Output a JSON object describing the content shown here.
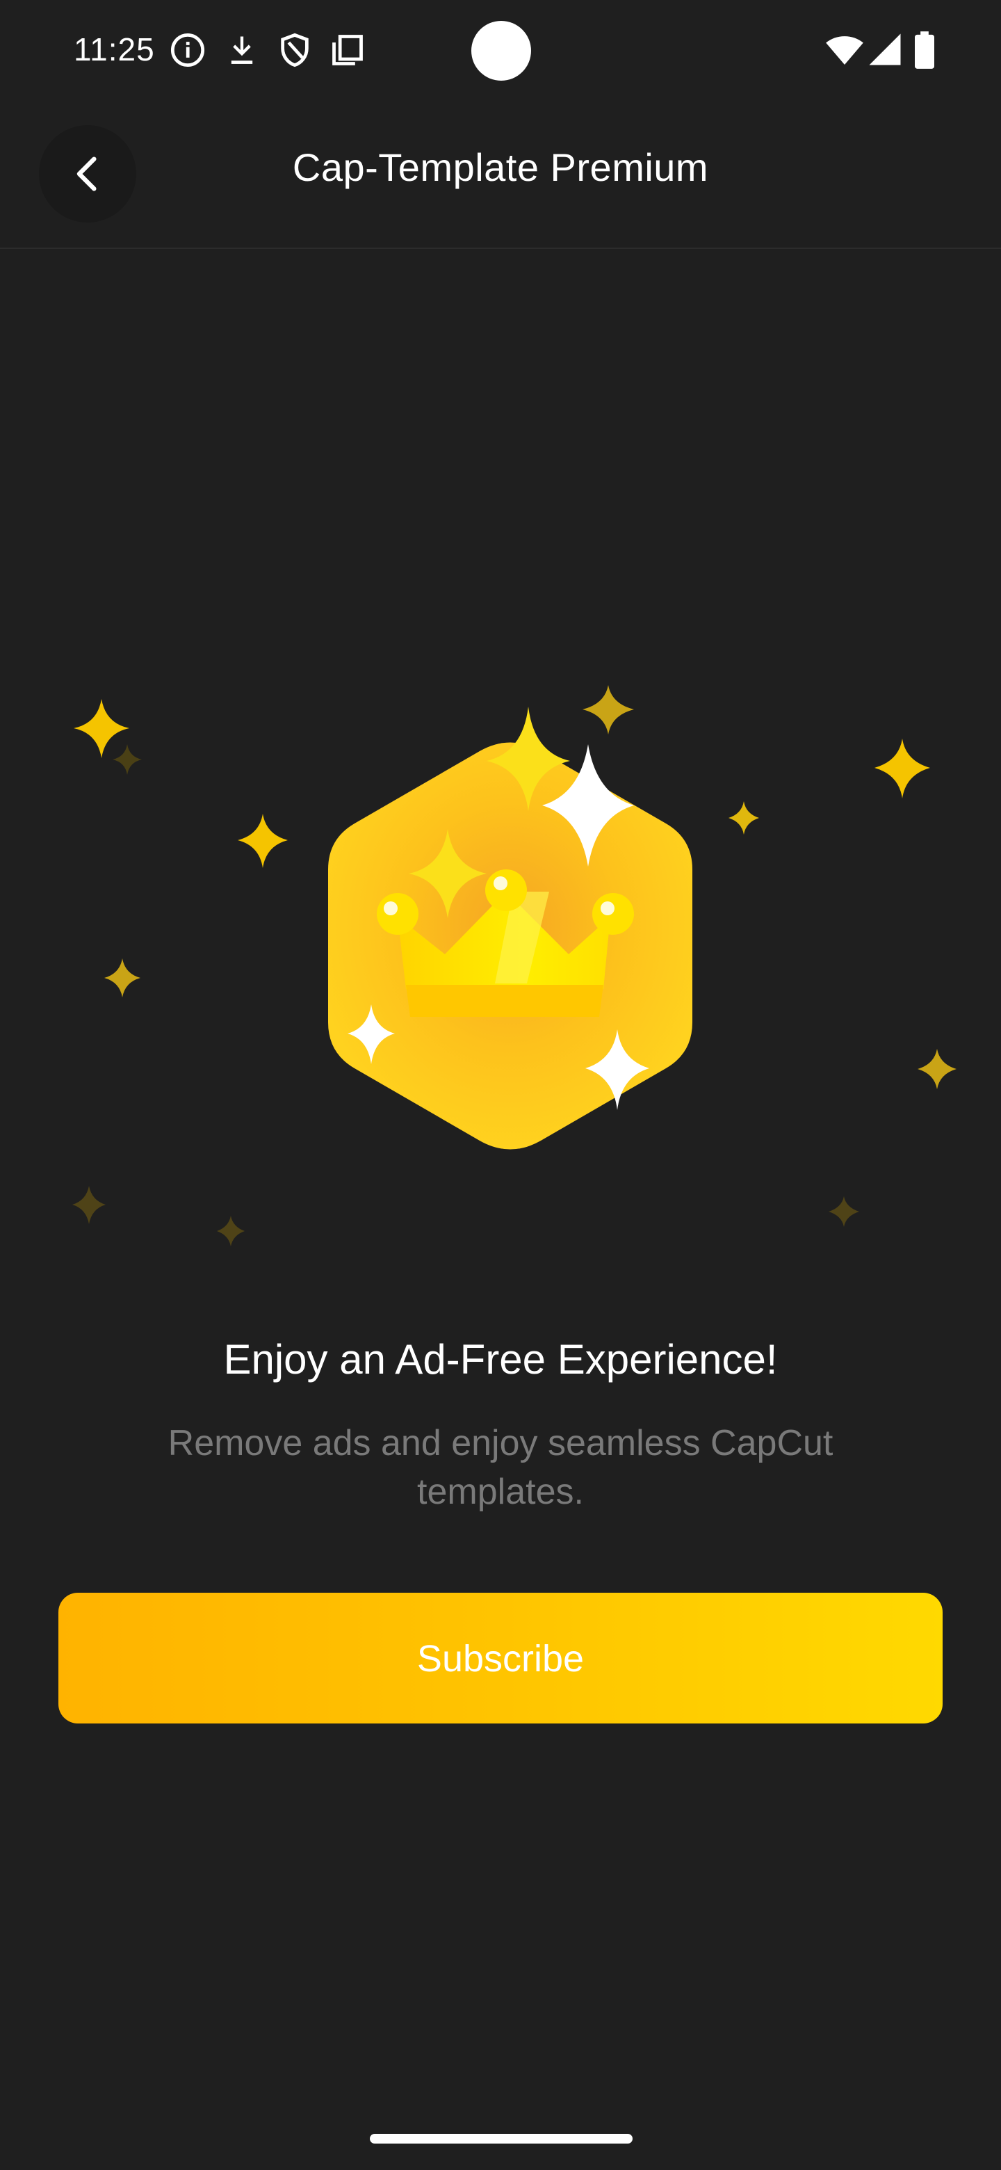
{
  "status_bar": {
    "time": "11:25",
    "icons": [
      "info-icon",
      "download-icon",
      "shield-icon",
      "copy-icon",
      "wifi-icon",
      "signal-icon",
      "battery-icon"
    ]
  },
  "app_bar": {
    "title": "Cap-Template Premium",
    "back_icon": "chevron-left-icon"
  },
  "illustration": {
    "name": "premium-crown-badge",
    "colors": {
      "badge": "#ffc81a",
      "crown": "#ffe100",
      "star_yellow": "#f5c400",
      "star_white": "#ffffff"
    }
  },
  "content": {
    "headline": "Enjoy an Ad-Free Experience!",
    "description": "Remove ads and enjoy seamless CapCut templates."
  },
  "actions": {
    "subscribe_label": "Subscribe"
  },
  "colors": {
    "background": "#1f1f1f",
    "button_gradient_start": "#ffb300",
    "button_gradient_end": "#ffd900",
    "subtext": "#7a7a7a"
  }
}
